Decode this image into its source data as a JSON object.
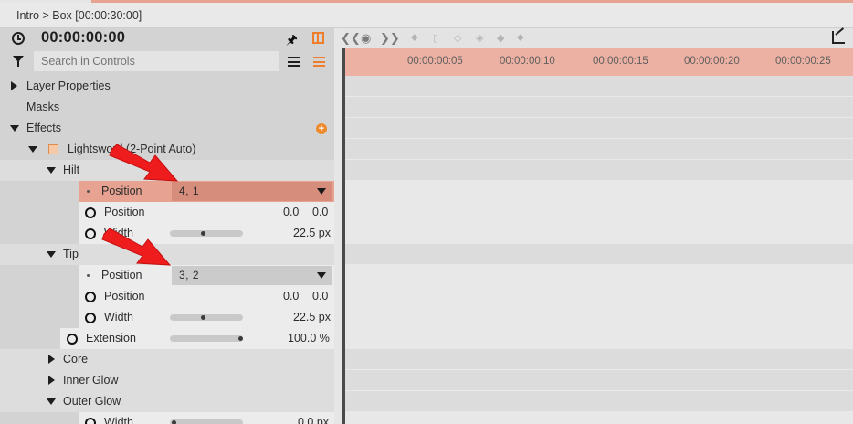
{
  "breadcrumb": "Intro > Box [00:00:30:00]",
  "timecode": "00:00:00:00",
  "search": {
    "placeholder": "Search in Controls"
  },
  "icons": {
    "clock": "clock-icon",
    "pin": "pin-icon",
    "panel": "panel-toggle-icon",
    "filter": "filter-icon",
    "list": "list-view-icon",
    "list_alt": "list-view-alt-icon",
    "graph": "graph-editor-icon"
  },
  "tree": {
    "layer_properties": "Layer Properties",
    "masks": "Masks",
    "effects": "Effects",
    "effect_name": "Lightsword (2-Point Auto)",
    "hilt": {
      "label": "Hilt",
      "position_dropdown_label": "Position",
      "position_dropdown_value": "4, 1",
      "position_label": "Position",
      "position_x": "0.0",
      "position_y": "0.0",
      "width_label": "Width",
      "width_value": "22.5 px",
      "width_slider": 0.45
    },
    "tip": {
      "label": "Tip",
      "position_dropdown_label": "Position",
      "position_dropdown_value": "3, 2",
      "position_label": "Position",
      "position_x": "0.0",
      "position_y": "0.0",
      "width_label": "Width",
      "width_value": "22.5 px",
      "width_slider": 0.45
    },
    "extension": {
      "label": "Extension",
      "value": "100.0 %",
      "slider": 1.0
    },
    "core": "Core",
    "inner_glow": "Inner Glow",
    "outer_glow": "Outer Glow",
    "outer_width_label": "Width",
    "outer_width_value": "0.0 px"
  },
  "ruler": {
    "ticks": [
      "00:00:00:05",
      "00:00:00:10",
      "00:00:00:15",
      "00:00:00:20",
      "00:00:00:25"
    ]
  },
  "colors": {
    "accent": "#ef7d2c",
    "ruler": "#ecb1a3",
    "selected_row": "#e7a291",
    "annotation_arrow": "#ee1c1c"
  }
}
